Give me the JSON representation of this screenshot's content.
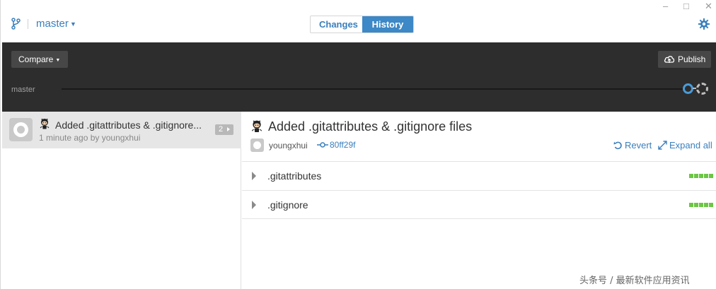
{
  "topbar": {
    "branch": "master",
    "tabs": [
      {
        "label": "Changes",
        "active": false
      },
      {
        "label": "History",
        "active": true
      }
    ],
    "window_controls": {
      "minimize": "–",
      "maximize": "□",
      "close": "✕"
    }
  },
  "toolbar": {
    "compare_label": "Compare",
    "publish_label": "Publish",
    "timeline_branch": "master"
  },
  "commits": [
    {
      "title": "Added .gitattributes & .gitignore...",
      "meta": "1 minute ago by youngxhui",
      "file_count": "2"
    }
  ],
  "detail": {
    "title": "Added .gitattributes & .gitignore files",
    "author": "youngxhui",
    "sha": "80ff29f",
    "revert_label": "Revert",
    "expand_label": "Expand all",
    "files": [
      {
        "name": ".gitattributes",
        "additions_shown": 5
      },
      {
        "name": ".gitignore",
        "additions_shown": 5
      }
    ]
  },
  "watermark": "头条号 / 最新软件应用资讯",
  "colors": {
    "accent": "#3a7fbd",
    "active_tab": "#3d88c6",
    "dark_band": "#2d2d2d",
    "diff_add": "#6cc644",
    "timeline_node": "#4a9bd8"
  },
  "icons": [
    "branch-icon",
    "gear-icon",
    "cloud-upload-icon",
    "octocat-icon",
    "commit-icon",
    "revert-icon",
    "expand-icon",
    "chevron-right-icon"
  ]
}
